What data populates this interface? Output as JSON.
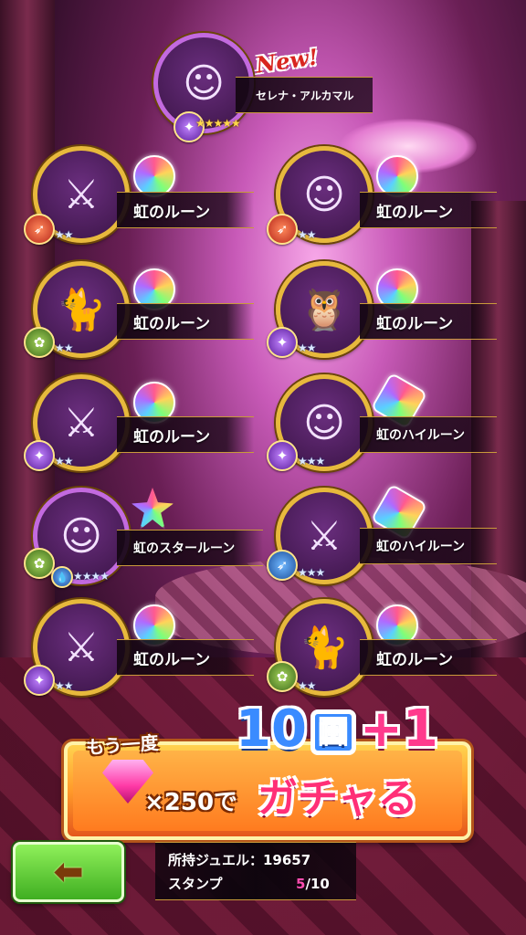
{
  "featured": {
    "badge": "New!",
    "name": "セレナ・アルカマル",
    "stars": "★★★★★",
    "element": "purple"
  },
  "results": [
    {
      "item": "虹のルーン",
      "stars": "★★",
      "element": "fire",
      "rune": "round"
    },
    {
      "item": "虹のルーン",
      "stars": "★★",
      "element": "fire",
      "rune": "round"
    },
    {
      "item": "虹のルーン",
      "stars": "★★",
      "element": "green",
      "rune": "round"
    },
    {
      "item": "虹のルーン",
      "stars": "★★",
      "element": "purple",
      "rune": "round"
    },
    {
      "item": "虹のルーン",
      "stars": "★★",
      "element": "purple",
      "rune": "round"
    },
    {
      "item": "虹のハイルーン",
      "stars": "★★★",
      "element": "purple",
      "rune": "hex"
    },
    {
      "item": "虹のスタールーン",
      "stars": "★★★★",
      "element": "green",
      "rune": "star"
    },
    {
      "item": "虹のハイルーン",
      "stars": "★★★",
      "element": "blue",
      "rune": "hex"
    },
    {
      "item": "虹のルーン",
      "stars": "★★",
      "element": "purple",
      "rune": "round"
    },
    {
      "item": "虹のルーン",
      "stars": "★★",
      "element": "green",
      "rune": "round"
    }
  ],
  "banner": {
    "again": "もう一度",
    "pull_count": "10",
    "pull_unit": "回",
    "bonus": "+1",
    "cost": "×250で",
    "action": "ガチャる"
  },
  "back_button": {
    "icon": "arrow-left-icon"
  },
  "status": {
    "jewel_label": "所持ジュエル：",
    "jewel_value": "19657",
    "stamp_label": "スタンプ",
    "stamp_current": "5",
    "stamp_total": "/10"
  }
}
